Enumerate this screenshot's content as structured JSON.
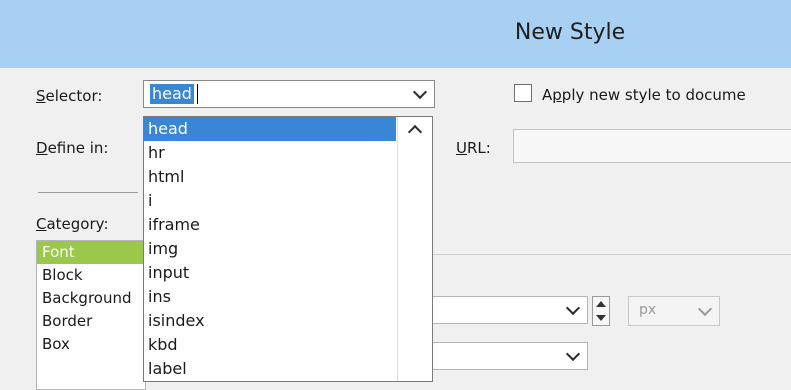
{
  "window": {
    "title": "New Style"
  },
  "selector": {
    "label": "Selector:",
    "value": "head"
  },
  "apply_checkbox": {
    "label": "Apply new style to docume",
    "checked": false
  },
  "define_in": {
    "label": "Define in:"
  },
  "url": {
    "label": "URL:"
  },
  "category": {
    "label": "Category:",
    "items": [
      "Font",
      "Block",
      "Background",
      "Border",
      "Box"
    ],
    "selected": "Font"
  },
  "selector_dropdown": {
    "items": [
      "head",
      "hr",
      "html",
      "i",
      "iframe",
      "img",
      "input",
      "ins",
      "isindex",
      "kbd",
      "label"
    ],
    "selected": "head"
  },
  "font_size_unit": {
    "value": "px"
  },
  "colors": {
    "title_bar": "#a8d0f3",
    "selection": "#3a86d6",
    "category_selected": "#99c84a"
  },
  "icons": [
    "chevron-down-icon",
    "chevron-up-icon",
    "spin-up-icon",
    "spin-down-icon"
  ]
}
